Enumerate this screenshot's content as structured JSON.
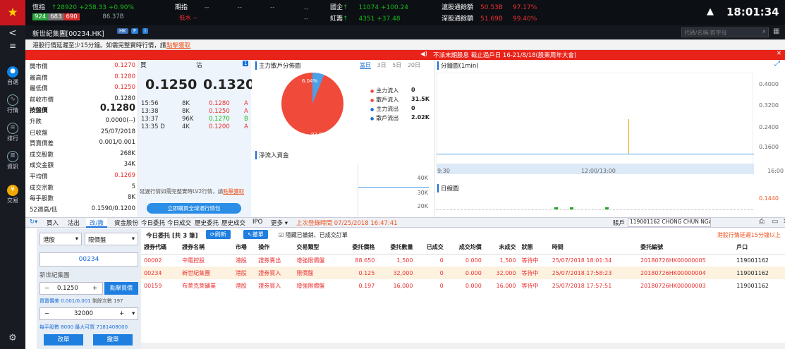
{
  "topbar": {
    "hsi_label": "恆指",
    "hsi_value": "28920",
    "hsi_change": "+258.33",
    "hsi_pct": "+0.90%",
    "hsi_up_count": "924",
    "hsi_down_count": "683",
    "hsi_flat_count": "690",
    "hsi_turnover": "86.37B",
    "fut_label": "期指",
    "fut_value": "--",
    "fut_value2": "--",
    "fut_value3": "--",
    "fut_sub": "低水 --",
    "gq_label": "國企",
    "gq_value": "11074",
    "gq_change": "+100.24",
    "hc_label": "紅籌",
    "hc_value": "4351",
    "hc_change": "+37.48",
    "sh_label": "滬股通餘額",
    "sh_value": "50.53B",
    "sh_pct": "97.17%",
    "sz_label": "深股通餘額",
    "sz_value": "51.69B",
    "sz_pct": "99.40%",
    "time": "18:01:34"
  },
  "sidebar": {
    "items": [
      {
        "label": "自選",
        "icon": "star-circle-icon"
      },
      {
        "label": "行情",
        "icon": "chart-line-icon"
      },
      {
        "label": "排行",
        "icon": "ranking-icon"
      },
      {
        "label": "資訊",
        "icon": "news-icon"
      },
      {
        "label": "交易",
        "icon": "trade-icon"
      }
    ],
    "settings_icon": "settings-icon"
  },
  "header": {
    "stock_name": "新世紀集團[00234.HK]",
    "search_placeholder": "代碼/名稱/首字母"
  },
  "notice": {
    "text": "港股行情延遲至少15分鐘。如需完整實時行情，請",
    "link": "點擊獲取"
  },
  "banner": {
    "text": "不派末期股息 截止過戶日 16-21/8/18(股東周年大會)"
  },
  "quote": {
    "rows": [
      {
        "label": "開市價",
        "value": "0.1270"
      },
      {
        "label": "最高價",
        "value": "0.1280"
      },
      {
        "label": "最低價",
        "value": "0.1250"
      },
      {
        "label": "前收市價",
        "value": "0.1280"
      },
      {
        "label": "按盤價",
        "value": "0.1280"
      },
      {
        "label": "升跌",
        "value": "0.0000(--)"
      },
      {
        "label": "已收盤",
        "value": "25/07/2018"
      },
      {
        "label": "買賣價差",
        "value": "0.001/0.001"
      },
      {
        "label": "成交股數",
        "value": "268K"
      },
      {
        "label": "成交金額",
        "value": "34K"
      },
      {
        "label": "平均價",
        "value": "0.1269"
      },
      {
        "label": "成交宗數",
        "value": "5"
      },
      {
        "label": "每手股數",
        "value": "8K"
      },
      {
        "label": "52週高/低",
        "value": "0.1590/0.1200"
      }
    ]
  },
  "orderbook": {
    "bid_label": "買",
    "ask_label": "沽",
    "bid_price": "0.1250",
    "ask_price": "0.1320",
    "ask_count": "1",
    "ticks": [
      {
        "time": "15:56",
        "vol": "8K",
        "price": "0.1280",
        "side": "A"
      },
      {
        "time": "13:38",
        "vol": "8K",
        "price": "0.1250",
        "side": "A"
      },
      {
        "time": "13:37",
        "vol": "96K",
        "price": "0.1270",
        "side": "B"
      },
      {
        "time": "13:35 D",
        "vol": "4K",
        "price": "0.1200",
        "side": "A"
      }
    ],
    "lv2_text": "延遲行情如需完整實時LV2行情，請",
    "lv2_link": "點擊獲取",
    "lv2_button": "立即購買全球通行情包"
  },
  "moneyflow": {
    "title": "主力散戶分佈圖",
    "tabs": [
      "當日",
      "3日",
      "5日",
      "20日"
    ],
    "pct_small": "6.04%",
    "pct_big": "93.96%",
    "legend": [
      {
        "label": "主力流入",
        "value": "0"
      },
      {
        "label": "散戶流入",
        "value": "31.5K"
      },
      {
        "label": "主力流出",
        "value": "0"
      },
      {
        "label": "散戶流出",
        "value": "2.02K"
      }
    ],
    "net_title": "淨流入資金",
    "net_ticks": [
      "40K",
      "30K",
      "20K"
    ]
  },
  "minute": {
    "title": "分鐘圖(1min)",
    "y": [
      "0.4000",
      "0.3200",
      "0.2400",
      "0.1600"
    ],
    "x": [
      "9:30",
      "12:00/13:00",
      "16:00"
    ],
    "daily_title": "日線圖",
    "daily_y": "0.1440"
  },
  "trade_tabs": {
    "buy": "買入",
    "sell": "沽出",
    "modify": "改/撤",
    "items": [
      "資金股份",
      "今日委托",
      "今日成交",
      "歷史委托",
      "歷史成交",
      "IPO",
      "更多"
    ],
    "last_login": "上次登錄時間 07/25/2018 16:47:41",
    "account_label": "賬戶",
    "account": "119001162 CHONG CHUN NGA"
  },
  "order_form": {
    "market": "港股",
    "order_type": "限價盤",
    "code": "00234",
    "name": "新世紀集團",
    "price": "0.1250",
    "price_btn": "點擊買價",
    "spread": "買賣價差 0.001/0.001",
    "remain": "剩餘次數 197",
    "qty": "32000",
    "lot_info": "每手股數 8000 最大可買 7181408000",
    "modify_btn": "改單",
    "cancel_btn": "撤單"
  },
  "orders": {
    "title": "今日委托 [共 3 筆]",
    "refresh": "刷新",
    "withdraw": "撤單",
    "filter": "隱藏已撤銷、已成交訂單",
    "delay_note": "港股行情延遲15分鐘以上",
    "columns": [
      "證券代碼",
      "證券名稱",
      "市場",
      "操作",
      "交易類型",
      "委托價格",
      "委托數量",
      "已成交",
      "成交均價",
      "未成交",
      "狀態",
      "時間",
      "委托編號",
      "戶口"
    ],
    "rows": [
      [
        "00002",
        "中電控股",
        "港股",
        "證券賣出",
        "增強限價盤",
        "88.650",
        "1,500",
        "0",
        "0.000",
        "1,500",
        "等待中",
        "25/07/2018 18:01:34",
        "20180726HK00000005",
        "119001162"
      ],
      [
        "00234",
        "新世紀集團",
        "港股",
        "證券買入",
        "限價盤",
        "0.125",
        "32,000",
        "0",
        "0.000",
        "32,000",
        "等待中",
        "25/07/2018 17:58:23",
        "20180726HK00000004",
        "119001162"
      ],
      [
        "00159",
        "布萊克萊礦業",
        "港股",
        "證券買入",
        "增強限價盤",
        "0.197",
        "16,000",
        "0",
        "0.000",
        "16,000",
        "等待中",
        "25/07/2018 17:57:51",
        "20180726HK00000003",
        "119001162"
      ]
    ]
  }
}
